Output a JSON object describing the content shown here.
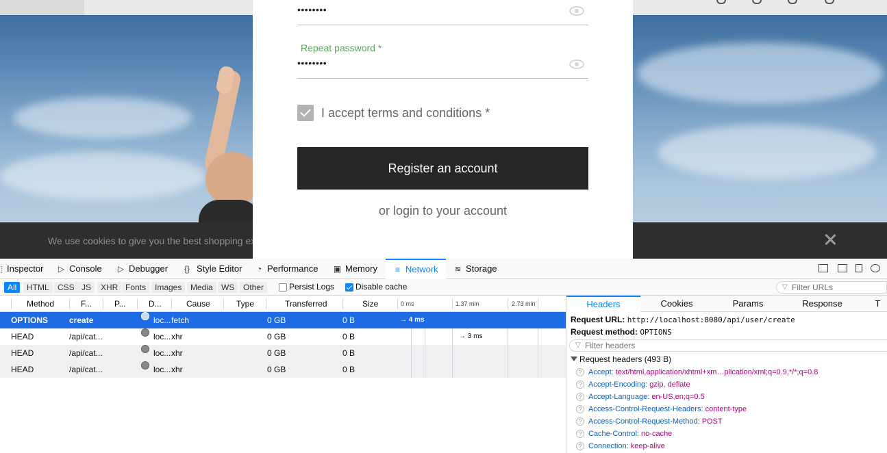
{
  "site": {
    "password_mask": "••••••••",
    "repeat_password_label": "Repeat password *",
    "repeat_password_mask": "••••••••",
    "terms_label": "I accept terms and conditions *",
    "register_button": "Register an account",
    "login_link": "or login to your account",
    "cookie_text": "We use cookies to give you the best shopping ex"
  },
  "devtools": {
    "tabs": [
      {
        "label": "Inspector",
        "icon": "inspector-icon",
        "glyph": "⬚"
      },
      {
        "label": "Console",
        "icon": "console-icon",
        "glyph": "▷"
      },
      {
        "label": "Debugger",
        "icon": "debugger-icon",
        "glyph": "▷"
      },
      {
        "label": "Style Editor",
        "icon": "style-editor-icon",
        "glyph": "{}"
      },
      {
        "label": "Performance",
        "icon": "performance-icon",
        "glyph": "◔"
      },
      {
        "label": "Memory",
        "icon": "memory-icon",
        "glyph": "▣"
      },
      {
        "label": "Network",
        "icon": "network-icon",
        "glyph": "≡"
      },
      {
        "label": "Storage",
        "icon": "storage-icon",
        "glyph": "≋"
      }
    ],
    "active_tab": "Network",
    "filter_types": [
      "All",
      "HTML",
      "CSS",
      "JS",
      "XHR",
      "Fonts",
      "Images",
      "Media",
      "WS",
      "Other"
    ],
    "persist_logs": {
      "label": "Persist Logs",
      "checked": false
    },
    "disable_cache": {
      "label": "Disable cache",
      "checked": true
    },
    "filter_urls_placeholder": "Filter URLs",
    "columns": [
      "Method",
      "F...",
      "P...",
      "D...",
      "Cause",
      "Type",
      "Transferred",
      "Size"
    ],
    "timeline_ticks": [
      "0 ms",
      "1.37 min",
      "2.73 min"
    ],
    "rows": [
      {
        "method": "OPTIONS",
        "file": "create",
        "domain": "loc...",
        "cause": "fetch",
        "type": "",
        "transferred": "0 GB",
        "size": "0 B",
        "timing": "→ 4 ms",
        "selected": true
      },
      {
        "method": "HEAD",
        "file": "/api/cat...",
        "domain": "loc...",
        "cause": "xhr",
        "type": "",
        "transferred": "0 GB",
        "size": "0 B",
        "timing": "→ 3 ms",
        "selected": false
      },
      {
        "method": "HEAD",
        "file": "/api/cat...",
        "domain": "loc...",
        "cause": "xhr",
        "type": "",
        "transferred": "0 GB",
        "size": "0 B",
        "timing": "",
        "selected": false
      },
      {
        "method": "HEAD",
        "file": "/api/cat...",
        "domain": "loc...",
        "cause": "xhr",
        "type": "",
        "transferred": "0 GB",
        "size": "0 B",
        "timing": "",
        "selected": false
      }
    ],
    "side_tabs": [
      "Headers",
      "Cookies",
      "Params",
      "Response",
      "T"
    ],
    "active_side_tab": "Headers",
    "request_url_label": "Request URL:",
    "request_url": "http://localhost:8080/api/user/create",
    "request_method_label": "Request method:",
    "request_method": "OPTIONS",
    "filter_headers_placeholder": "Filter headers",
    "request_headers_title": "Request headers (493 B)",
    "headers": [
      {
        "name": "Accept:",
        "value": "text/html,application/xhtml+xm…plication/xml;q=0.9,*/*;q=0.8"
      },
      {
        "name": "Accept-Encoding:",
        "value": "gzip, deflate"
      },
      {
        "name": "Accept-Language:",
        "value": "en-US,en;q=0.5"
      },
      {
        "name": "Access-Control-Request-Headers:",
        "value": "content-type"
      },
      {
        "name": "Access-Control-Request-Method:",
        "value": "POST"
      },
      {
        "name": "Cache-Control:",
        "value": "no-cache"
      },
      {
        "name": "Connection:",
        "value": "keep-alive"
      }
    ]
  }
}
